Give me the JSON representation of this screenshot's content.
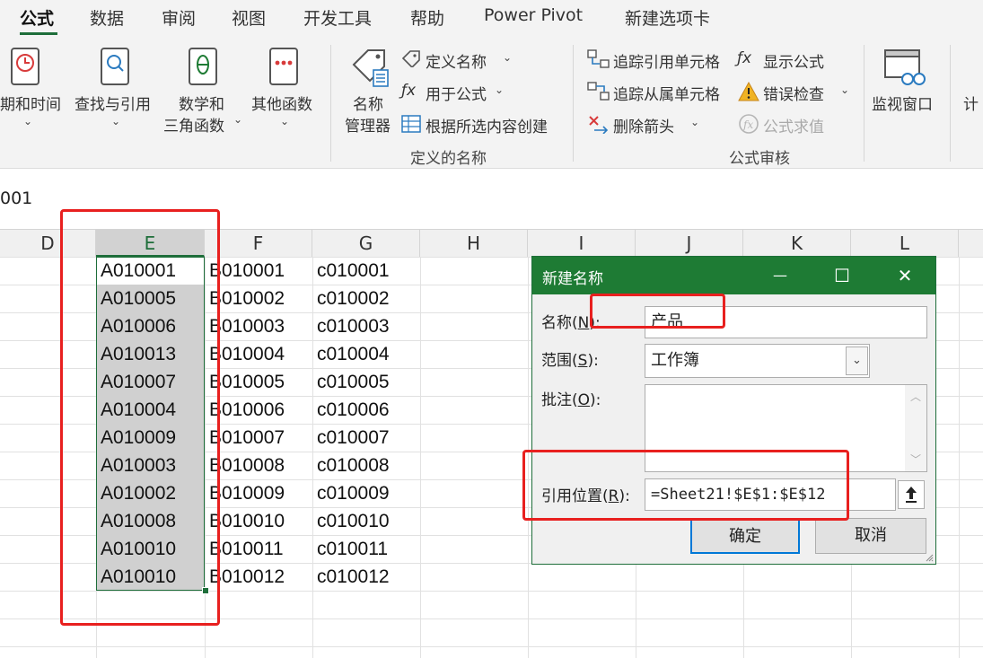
{
  "ribbon": {
    "tabs": [
      "公式",
      "数据",
      "审阅",
      "视图",
      "开发工具",
      "帮助",
      "Power Pivot",
      "新建选项卡"
    ],
    "function_library": {
      "datetime": "期和时间",
      "lookup": "查找与引用",
      "math_line1": "数学和",
      "math_line2": "三角函数",
      "other": "其他函数"
    },
    "defined_names": {
      "name_manager_line1": "名称",
      "name_manager_line2": "管理器",
      "define_name": "定义名称",
      "use_in_formula": "用于公式",
      "create_from_selection": "根据所选内容创建",
      "group_label": "定义的名称"
    },
    "formula_auditing": {
      "trace_precedents": "追踪引用单元格",
      "trace_dependents": "追踪从属单元格",
      "remove_arrows": "删除箭头",
      "show_formulas": "显示公式",
      "error_checking": "错误检查",
      "evaluate_formula": "公式求值",
      "group_label": "公式审核"
    },
    "watch_window": "监视窗口",
    "calculation_partial": "计"
  },
  "formula_bar": {
    "value_partial": "001"
  },
  "grid": {
    "columns": [
      "D",
      "E",
      "F",
      "G",
      "H",
      "I",
      "J",
      "K",
      "L"
    ],
    "selected_column": "E",
    "col_E": [
      "A010001",
      "A010005",
      "A010006",
      "A010013",
      "A010007",
      "A010004",
      "A010009",
      "A010003",
      "A010002",
      "A010008",
      "A010010",
      "A010010"
    ],
    "col_F": [
      "B010001",
      "B010002",
      "B010003",
      "B010004",
      "B010005",
      "B010006",
      "B010007",
      "B010008",
      "B010009",
      "B010010",
      "B010011",
      "B010012"
    ],
    "col_G": [
      "c010001",
      "c010002",
      "c010003",
      "c010004",
      "c010005",
      "c010006",
      "c010007",
      "c010008",
      "c010009",
      "c010010",
      "c010011",
      "c010012"
    ]
  },
  "dialog": {
    "title": "新建名称",
    "name_label_prefix": "名称(",
    "name_label_key": "N",
    "name_label_suffix": "):",
    "name_value": "产品",
    "scope_label_prefix": "范围(",
    "scope_label_key": "S",
    "scope_label_suffix": "):",
    "scope_value": "工作簿",
    "comment_label_prefix": "批注(",
    "comment_label_key": "O",
    "comment_label_suffix": "):",
    "comment_value": "",
    "refers_label_prefix": "引用位置(",
    "refers_label_key": "R",
    "refers_label_suffix": "):",
    "refers_value": "=Sheet21!$E$1:$E$12",
    "ok": "确定",
    "cancel": "取消",
    "minimize_glyph": "—",
    "maximize_glyph": "☐",
    "close_glyph": "✕"
  },
  "colors": {
    "accent": "#1e7b34",
    "highlight": "#e8201f",
    "selection": "#d0d0d0"
  }
}
